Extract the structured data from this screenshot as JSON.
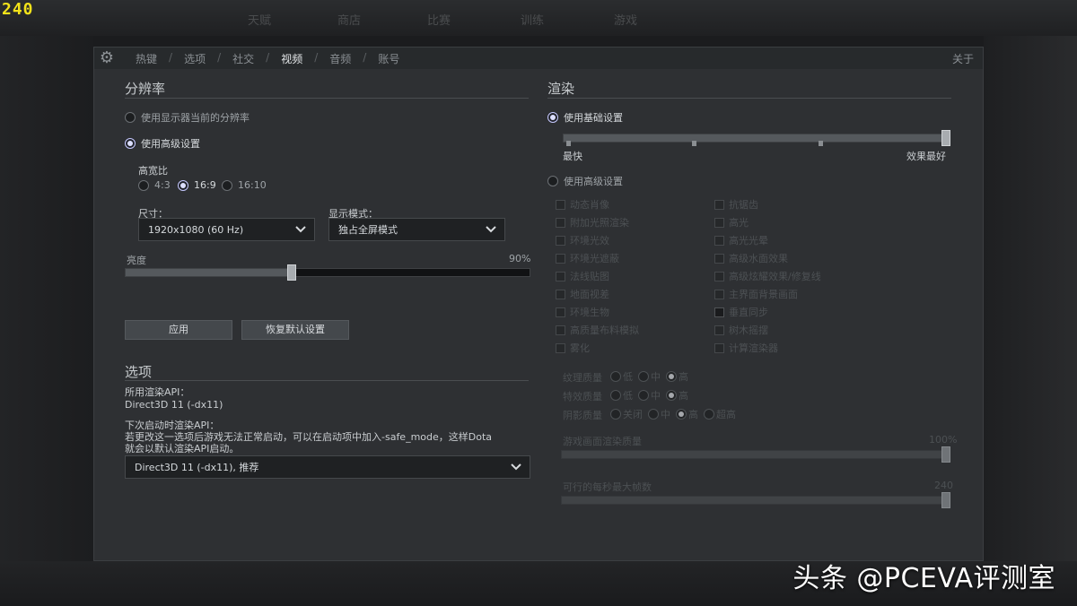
{
  "overlay": {
    "fps": "240",
    "watermark": "头条 @PCEVA评测室"
  },
  "tabs": [
    "热键",
    "选项",
    "社交",
    "视频",
    "音频",
    "账号"
  ],
  "tab_sep": "/",
  "about": "关于",
  "resolution": {
    "title": "分辨率",
    "use_monitor": "使用显示器当前的分辨率",
    "use_advanced": "使用高级设置",
    "aspect_title": "高宽比",
    "aspect": [
      "4:3",
      "16:9",
      "16:10"
    ],
    "size_label": "尺寸：",
    "size_value": "1920x1080 (60 Hz)",
    "display_mode_label": "显示模式：",
    "display_mode_value": "独占全屏模式",
    "brightness_label": "亮度",
    "brightness_value": "90%",
    "brightness_fraction": 0.41,
    "apply": "应用",
    "restore": "恢复默认设置"
  },
  "options": {
    "title": "选项",
    "api_label": "所用渲染API：",
    "api_value": "Direct3D 11 (-dx11)",
    "next_label": "下次启动时渲染API：",
    "next_note_1": "若更改这一选项后游戏无法正常启动，可以在启动项中加入-safe_mode，这样Dota",
    "next_note_2": "就会以默认渲染API启动。",
    "next_value": "Direct3D 11 (-dx11), 推荐"
  },
  "render": {
    "title": "渲染",
    "use_basic": "使用基础设置",
    "slider_min": "最快",
    "slider_max": "效果最好",
    "use_advanced": "使用高级设置",
    "checks_left": [
      "动态肖像",
      "附加光照渲染",
      "环境光效",
      "环境光遮蔽",
      "法线贴图",
      "地面视差",
      "环境生物",
      "高质量布料模拟",
      "雾化"
    ],
    "checks_right": [
      "抗锯齿",
      "高光",
      "高光光晕",
      "高级水面效果",
      "高级炫耀效果/修复线",
      "主界面背景画面",
      "垂直同步",
      "树木摇摆",
      "计算渲染器"
    ],
    "texture_label": "纹理质量",
    "effects_label": "特效质量",
    "shadow_label": "阴影质量",
    "opt_low": "低",
    "opt_mid": "中",
    "opt_high": "高",
    "opt_off": "关闭",
    "opt_ultra": "超高",
    "render_quality_label": "游戏画面渲染质量",
    "render_quality_value": "100%",
    "fps_label": "可行的每秒最大帧数",
    "fps_value": "240"
  },
  "bg_ghost": [
    "天赋",
    "商店",
    "比赛",
    "训练",
    "游戏"
  ],
  "colors": {
    "panel": "#2e3033",
    "accent_radio": "#dcdfff",
    "fps": "#f2e21a"
  }
}
